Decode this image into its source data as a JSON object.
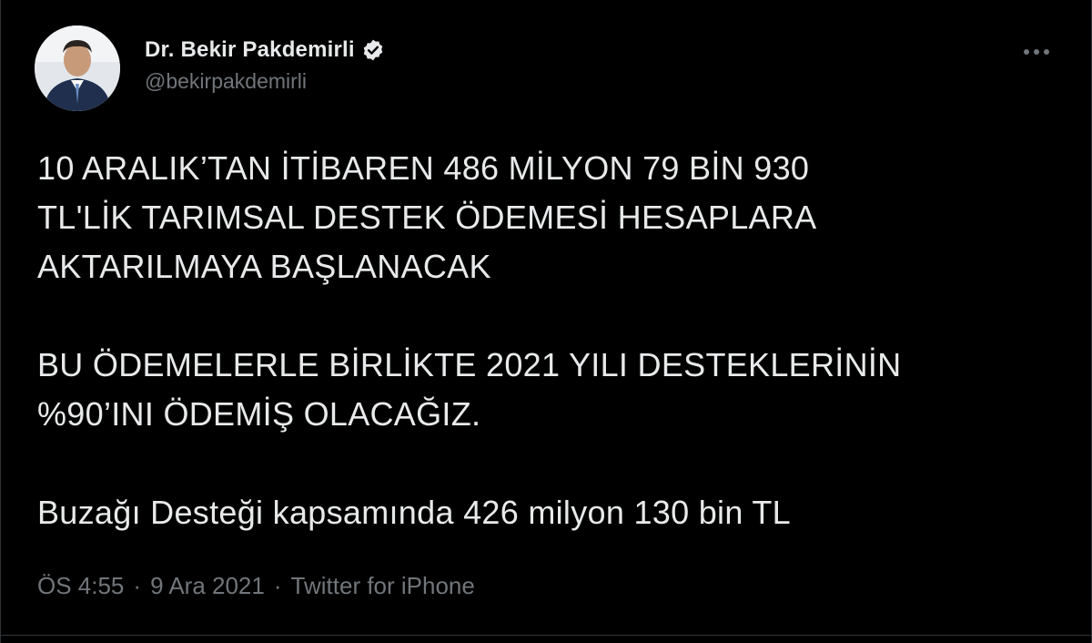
{
  "author": {
    "display_name": "Dr. Bekir Pakdemirli",
    "handle": "@bekirpakdemirli",
    "verified": true,
    "avatar_icon": "profile-photo"
  },
  "more_icon": "more-horizontal-icon",
  "tweet": {
    "paragraph_1": "10 ARALIK’TAN İTİBAREN 486 MİLYON 79 BİN 930\nTL'LİK TARIMSAL DESTEK ÖDEMESİ HESAPLARA\nAKTARILMAYA BAŞLANACAK",
    "paragraph_2": "BU ÖDEMELERLE BİRLİKTE 2021 YILI DESTEKLERİNİN\n%90’INI ÖDEMİŞ OLACAĞIZ.",
    "paragraph_3": "Buzağı Desteği kapsamında 426 milyon 130 bin TL"
  },
  "meta": {
    "time": "ÖS 4:55",
    "separator_1": "·",
    "date": "9 Ara 2021",
    "separator_2": "·",
    "source": "Twitter for iPhone"
  },
  "colors": {
    "background": "#000000",
    "text": "#e7e9ea",
    "secondary": "#71767b",
    "verified_badge": "#e7e9ea"
  }
}
